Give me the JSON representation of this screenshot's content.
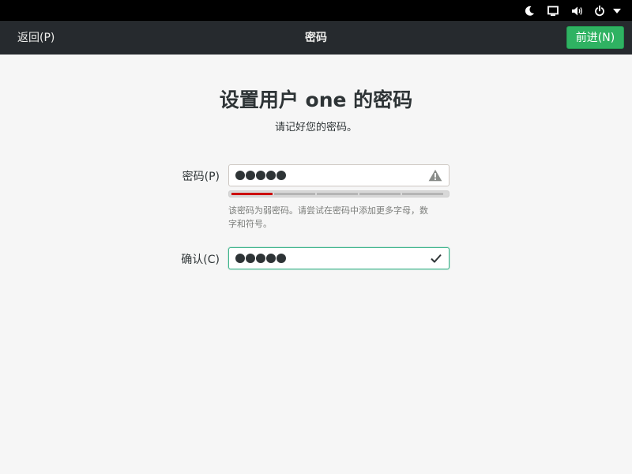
{
  "system_tray": {
    "icons": [
      "night-light-icon",
      "display-icon",
      "volume-icon",
      "power-icon",
      "menu-caret-icon"
    ]
  },
  "headerbar": {
    "back_label": "返回(P)",
    "title": "密码",
    "next_label": "前进(N)",
    "next_color": "#2fb262"
  },
  "main": {
    "title": "设置用户 one 的密码",
    "subtitle": "请记好您的密码。",
    "password": {
      "label": "密码(P)",
      "masked_length": 5,
      "status_icon": "warning-icon"
    },
    "strength": {
      "level": 1,
      "segments": 5,
      "fill_color": "#cc0000"
    },
    "hint_line1": "该密码为弱密码。请尝试在密码中添加更多字母，数",
    "hint_line2": "字和符号。",
    "confirm": {
      "label": "确认(C)",
      "masked_length": 5,
      "status_icon": "check-icon",
      "focus_color": "#3eb48c"
    }
  }
}
